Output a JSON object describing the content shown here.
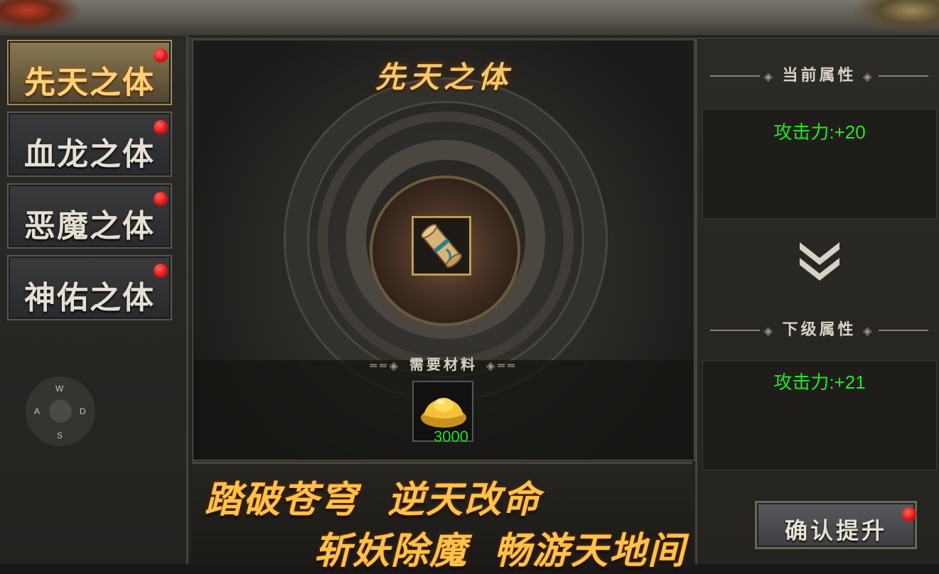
{
  "tabs": [
    {
      "label": "先天之体",
      "active": true
    },
    {
      "label": "血龙之体",
      "active": false
    },
    {
      "label": "恶魔之体",
      "active": false
    },
    {
      "label": "神佑之体",
      "active": false
    }
  ],
  "joystick": {
    "up": "W",
    "left": "A",
    "right": "D",
    "down": "S"
  },
  "center": {
    "title": "先天之体",
    "material_title": "需要材料",
    "material_count": "3000",
    "item_icon": "scroll-icon",
    "material_icon": "gold-ingot-icon"
  },
  "slogan": {
    "line1a": "踏破苍穹",
    "line1b": "逆天改命",
    "line2a": "斩妖除魔",
    "line2b": "畅游天地间"
  },
  "right": {
    "current_title": "当前属性",
    "current_attr": "攻击力:+20",
    "next_title": "下级属性",
    "next_attr": "攻击力:+21",
    "confirm_label": "确认提升"
  },
  "colors": {
    "attr_green": "#1fea1f",
    "gold_title": "#f5c86a",
    "red_dot": "#e0141a"
  }
}
